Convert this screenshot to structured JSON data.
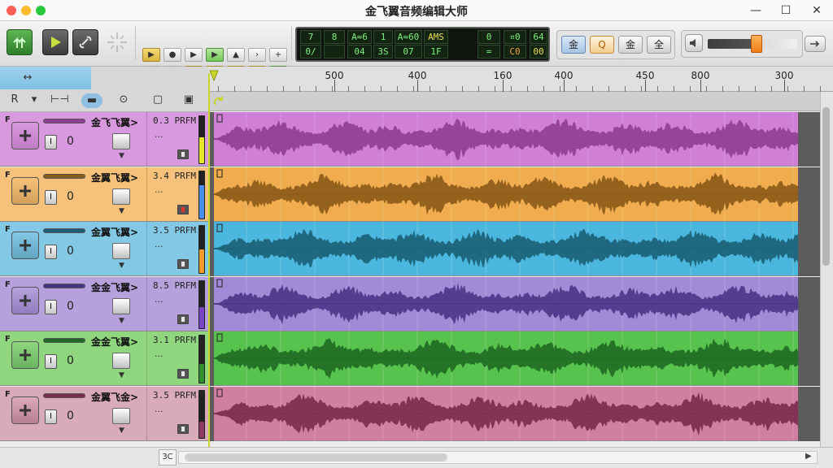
{
  "window": {
    "title": "金飞翼音频编辑大师",
    "controls": {
      "minimize": "—",
      "maximize": "☐",
      "close": "✕"
    }
  },
  "toolbar": {
    "grid_top": [
      "▶",
      "●",
      "▶",
      "▶",
      "▲",
      "›",
      "+"
    ],
    "grid_bottom": [
      "t",
      "⊣",
      "▶",
      "▶",
      "▶",
      "▶",
      "✦"
    ],
    "lcd_top": [
      "7",
      "8",
      "A≈6",
      "1",
      "A≈60",
      "AMS",
      "0",
      "¤0",
      "64"
    ],
    "lcd_bottom": [
      "0/",
      "",
      "04",
      "3S",
      "07",
      "1F",
      "=",
      "C0",
      "00"
    ],
    "mode_buttons": [
      "金",
      "Q",
      "金",
      "全"
    ],
    "volume_level": 0.55
  },
  "left_header": {
    "top_icon": "↔",
    "tools": [
      "R",
      "▾",
      "⊢⊣",
      "▬",
      "⊙",
      "▢",
      "▣"
    ]
  },
  "ruler": {
    "labels": [
      "500",
      "400",
      "160",
      "400",
      "450",
      "800",
      "300"
    ]
  },
  "tracks": [
    {
      "id": "t1",
      "name": "金飞飞翼>",
      "rate": "0.3 PRFM",
      "solo": "I",
      "value": "0",
      "color": "#d999de",
      "dark": "#8e3e93",
      "lane": "#cf7fd6",
      "meter": 0.55,
      "meter_color": "#e8e32a"
    },
    {
      "id": "t2",
      "name": "金翼飞翼>",
      "rate": "3.4 PRFM",
      "solo": "I",
      "value": "0",
      "color": "#f6c27b",
      "dark": "#8a5a18",
      "lane": "#f0ac4e",
      "meter": 0.7,
      "meter_color": "#4d8ef0"
    },
    {
      "id": "t3",
      "name": "金翼飞翼>",
      "rate": "3.5 PRFM",
      "solo": "I",
      "value": "0",
      "color": "#83c9e6",
      "dark": "#1b6076",
      "lane": "#4cb7de",
      "meter": 0.5,
      "meter_color": "#f09a2a"
    },
    {
      "id": "t4",
      "name": "金金飞翼>",
      "rate": "8.5 PRFM",
      "solo": "I",
      "value": "0",
      "color": "#b6a1dc",
      "dark": "#4a3486",
      "lane": "#a38ad6",
      "meter": 0.45,
      "meter_color": "#7a45c9"
    },
    {
      "id": "t5",
      "name": "金金飞翼>",
      "rate": "3.1 PRFM",
      "solo": "I",
      "value": "0",
      "color": "#8fd67f",
      "dark": "#1f6a22",
      "lane": "#57c34e",
      "meter": 0.4,
      "meter_color": "#2f8e2f"
    },
    {
      "id": "t6",
      "name": "金翼飞金>",
      "rate": "3.5 PRFM",
      "solo": "I",
      "value": "0",
      "color": "#d9aab7",
      "dark": "#7b2b4d",
      "lane": "#d07fa0",
      "meter": 0.35,
      "meter_color": "#8e3a63"
    }
  ],
  "status": {
    "corner_label": "3C"
  },
  "colors": {
    "accent_green": "#3f8f3a",
    "playhead": "#c8d62a"
  }
}
